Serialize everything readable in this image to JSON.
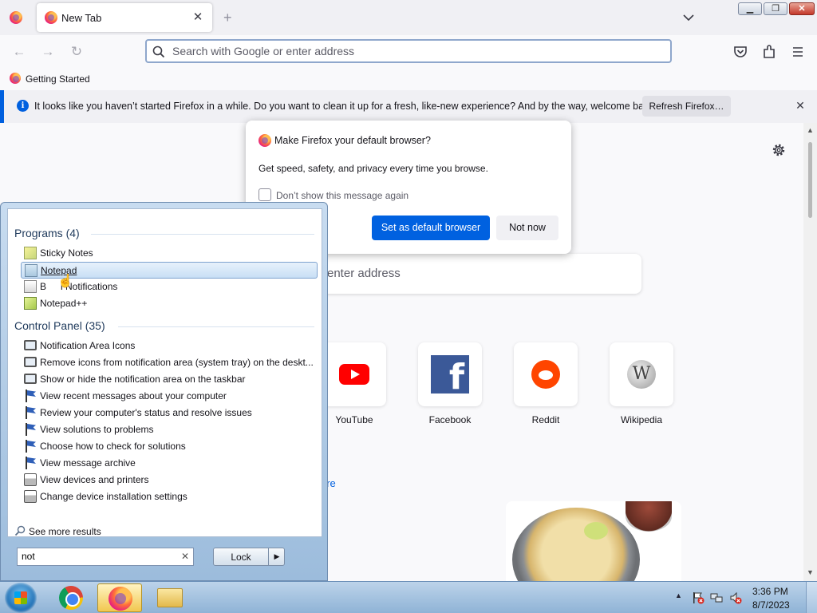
{
  "browser": {
    "tab": {
      "title": "New Tab"
    },
    "urlbar": {
      "placeholder": "Search with Google or enter address"
    },
    "bookmarks": [
      {
        "label": "Getting Started"
      }
    ],
    "notification": {
      "text": "It looks like you haven’t started Firefox in a while. Do you want to clean it up for a fresh, like-new experience? And by the way, welcome back!",
      "button_label": "Refresh Firefox…"
    },
    "content": {
      "search_partial_text": "enter address",
      "top_sites": [
        {
          "label": "YouTube",
          "icon": "youtube-icon"
        },
        {
          "label": "Facebook",
          "icon": "facebook-icon"
        },
        {
          "label": "Reddit",
          "icon": "reddit-icon"
        },
        {
          "label": "Wikipedia",
          "icon": "wikipedia-icon"
        }
      ],
      "more_link_partial": "ore"
    }
  },
  "default_dialog": {
    "title": "Make Firefox your default browser?",
    "body": "Get speed, safety, and privacy every time you browse.",
    "checkbox_label": "Don’t show this message again",
    "primary_button": "Set as default browser",
    "secondary_button": "Not now"
  },
  "start_menu": {
    "programs_header": "Programs (4)",
    "programs": [
      {
        "label": "Sticky Notes",
        "icon": "sticky-notes-icon"
      },
      {
        "label": "Notepad",
        "icon": "notepad-icon",
        "selected": true
      },
      {
        "label": "Balloon Notifications",
        "visible_label": "B",
        "visible_label_tail": "l Notifications",
        "icon": "notifications-icon"
      },
      {
        "label": "Notepad++",
        "icon": "notepad-plus-plus-icon"
      }
    ],
    "control_panel_header": "Control Panel (35)",
    "control_panel": [
      {
        "label": "Notification Area Icons",
        "icon": "monitor-icon"
      },
      {
        "label": "Remove icons from notification area (system tray) on the deskt...",
        "icon": "monitor-icon"
      },
      {
        "label": "Show or hide the notification area on the taskbar",
        "icon": "monitor-icon"
      },
      {
        "label": "View recent messages about your computer",
        "icon": "flag-icon"
      },
      {
        "label": "Review your computer's status and resolve issues",
        "icon": "flag-icon"
      },
      {
        "label": "View solutions to problems",
        "icon": "flag-icon"
      },
      {
        "label": "Choose how to check for solutions",
        "icon": "flag-icon"
      },
      {
        "label": "View message archive",
        "icon": "flag-icon"
      },
      {
        "label": "View devices and printers",
        "icon": "printer-icon"
      },
      {
        "label": "Change device installation settings",
        "icon": "printer-icon"
      }
    ],
    "see_more": "See more results",
    "search_value": "not",
    "power_button": "Lock"
  },
  "taskbar": {
    "apps": [
      "Google Chrome",
      "Firefox",
      "Windows Explorer"
    ],
    "clock": {
      "time": "3:36 PM",
      "date": "8/7/2023"
    }
  }
}
